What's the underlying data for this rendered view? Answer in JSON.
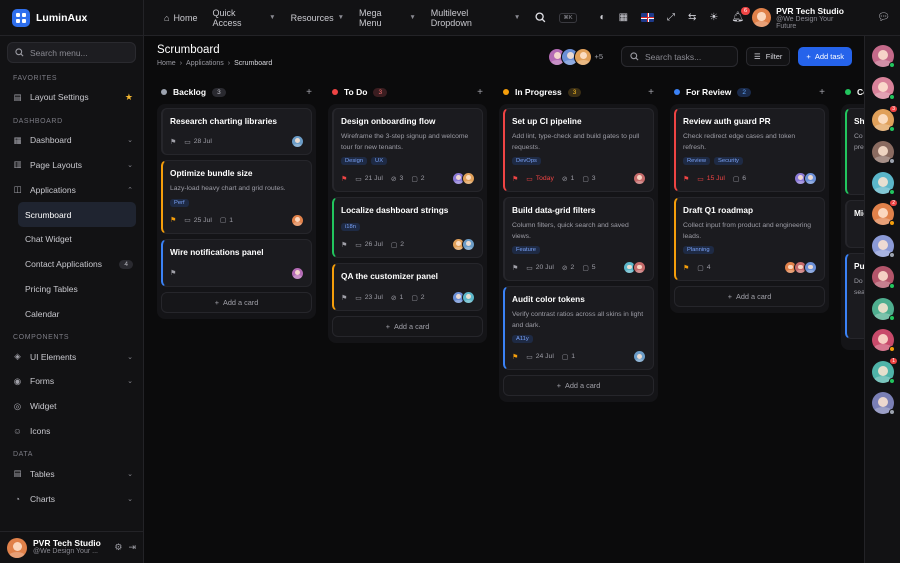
{
  "brand": {
    "name": "LuminAux"
  },
  "sidebar": {
    "search_placeholder": "Search menu...",
    "favorites_title": "FAVORITES",
    "favorites": [
      {
        "label": "Layout Settings",
        "icon": "layout-icon"
      }
    ],
    "dashboard_title": "DASHBOARD",
    "dashboard_items": [
      {
        "label": "Dashboard",
        "icon": "grid-icon"
      },
      {
        "label": "Page Layouts",
        "icon": "layout-icon"
      },
      {
        "label": "Applications",
        "icon": "apps-icon"
      }
    ],
    "app_sub": [
      "Scrumboard",
      "Chat Widget",
      "Contact Applications",
      "Pricing Tables",
      "Calendar"
    ],
    "contact_count": "4",
    "components_title": "COMPONENTS",
    "components_items": [
      {
        "label": "UI Elements",
        "icon": "cube-icon"
      },
      {
        "label": "Forms",
        "icon": "form-icon"
      },
      {
        "label": "Widget",
        "icon": "widget-icon"
      },
      {
        "label": "Icons",
        "icon": "smile-icon"
      }
    ],
    "data_title": "DATA",
    "data_items": [
      {
        "label": "Tables",
        "icon": "table-icon"
      },
      {
        "label": "Charts",
        "icon": "chart-icon"
      }
    ],
    "user": {
      "name": "PVR Tech Studio",
      "sub": "@We Design Your ..."
    }
  },
  "topbar": {
    "links": [
      "Home",
      "Quick Access",
      "Resources",
      "Mega Menu",
      "Multilevel Dropdown"
    ],
    "kbd": "⌘K",
    "notif_count": "6",
    "user": {
      "name": "PVR Tech Studio",
      "sub": "@We Design Your Future"
    }
  },
  "page": {
    "title": "Scrumboard",
    "crumbs": [
      "Home",
      "Applications",
      "Scrumboard"
    ],
    "more_members": "+5",
    "search_placeholder": "Search tasks...",
    "filter_label": "Filter",
    "add_label": "Add task"
  },
  "board": {
    "add_card_label": "Add a card",
    "columns": [
      {
        "name": "Backlog",
        "count": "3",
        "color": "#9ca3af",
        "cards": [
          {
            "title": "Research charting libraries",
            "date": "28 Jul"
          },
          {
            "title": "Optimize bundle size",
            "desc": "Lazy-load heavy chart and grid routes.",
            "tags": [
              "Perf"
            ],
            "date": "25 Jul",
            "comments": "1"
          },
          {
            "title": "Wire notifications panel"
          }
        ]
      },
      {
        "name": "To Do",
        "count": "3",
        "color": "#ef4444",
        "cards": [
          {
            "title": "Design onboarding flow",
            "desc": "Wireframe the 3-step signup and welcome tour for new tenants.",
            "tags": [
              "Design",
              "UX"
            ],
            "date": "21 Jul",
            "attach": "3",
            "comments": "2"
          },
          {
            "title": "Localize dashboard strings",
            "tags": [
              "i18n"
            ],
            "date": "26 Jul",
            "comments": "2"
          },
          {
            "title": "QA the customizer panel",
            "date": "23 Jul",
            "attach": "1",
            "comments": "2"
          }
        ]
      },
      {
        "name": "In Progress",
        "count": "3",
        "color": "#f59e0b",
        "cards": [
          {
            "title": "Set up CI pipeline",
            "desc": "Add lint, type-check and build gates to pull requests.",
            "tags": [
              "DevOps"
            ],
            "date": "Today",
            "attach": "1",
            "comments": "3"
          },
          {
            "title": "Build data-grid filters",
            "desc": "Column filters, quick search and saved views.",
            "tags": [
              "Feature"
            ],
            "date": "20 Jul",
            "attach": "2",
            "comments": "5"
          },
          {
            "title": "Audit color tokens",
            "desc": "Verify contrast ratios across all skins in light and dark.",
            "tags": [
              "A11y"
            ],
            "date": "24 Jul",
            "comments": "1"
          }
        ]
      },
      {
        "name": "For Review",
        "count": "2",
        "color": "#3b82f6",
        "cards": [
          {
            "title": "Review auth guard PR",
            "desc": "Check redirect edge cases and token refresh.",
            "tags": [
              "Review",
              "Security"
            ],
            "date": "15 Jul",
            "comments": "6"
          },
          {
            "title": "Draft Q1 roadmap",
            "desc": "Collect input from product and engineering leads.",
            "tags": [
              "Planning"
            ],
            "comments": "4"
          }
        ]
      },
      {
        "name": "Co",
        "color": "#22c55e",
        "cards": [
          {
            "title": "Sh",
            "desc": "Co\npre"
          },
          {
            "title": "Mig"
          },
          {
            "title": "Pu",
            "desc": "Do\nsea"
          }
        ]
      }
    ]
  },
  "rail": {
    "badges": [
      "3",
      "2",
      "1"
    ]
  }
}
